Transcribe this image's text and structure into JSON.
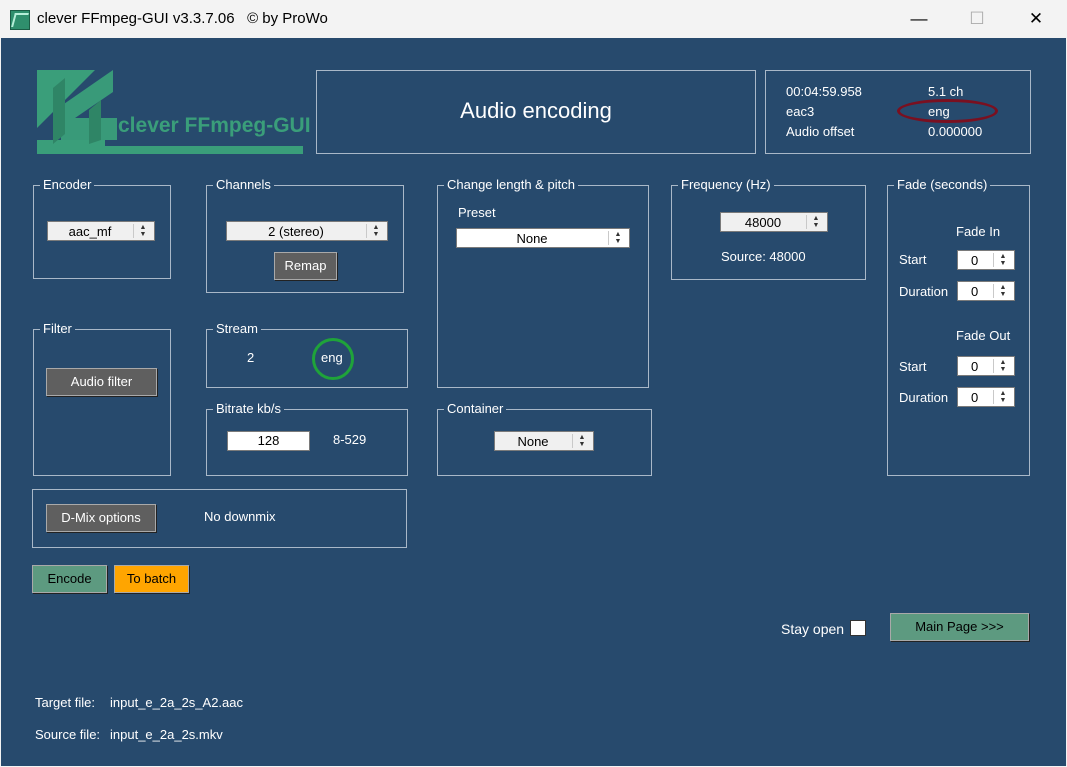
{
  "window": {
    "title": "clever FFmpeg-GUI v3.3.7.06   © by ProWo",
    "minimize_glyph": "—",
    "maximize_glyph": "☐",
    "close_glyph": "✕"
  },
  "logo": {
    "text": "clever FFmpeg-GUI",
    "color": "#3a9e7a"
  },
  "header": {
    "title": "Audio encoding"
  },
  "info": {
    "duration": "00:04:59.958",
    "channels": "5.1 ch",
    "codec": "eac3",
    "language": "eng",
    "offset_label": "Audio offset",
    "offset_value": "0.000000"
  },
  "encoder": {
    "label": "Encoder",
    "value": "aac_mf"
  },
  "channels": {
    "label": "Channels",
    "value": "2 (stereo)",
    "remap_label": "Remap"
  },
  "pitch": {
    "label": "Change length & pitch",
    "preset_label": "Preset",
    "preset_value": "None"
  },
  "frequency": {
    "label": "Frequency (Hz)",
    "value": "48000",
    "source_text": "Source: 48000"
  },
  "fade": {
    "label": "Fade (seconds)",
    "fade_in_label": "Fade In",
    "fade_out_label": "Fade Out",
    "start_label": "Start",
    "duration_label": "Duration",
    "in_start": "0",
    "in_duration": "0",
    "out_start": "0",
    "out_duration": "0"
  },
  "filter": {
    "label": "Filter",
    "button_label": "Audio filter"
  },
  "stream": {
    "label": "Stream",
    "number": "2",
    "language": "eng"
  },
  "bitrate": {
    "label": "Bitrate kb/s",
    "value": "128",
    "range": "8-529"
  },
  "container": {
    "label": "Container",
    "value": "None"
  },
  "dmix": {
    "button_label": "D-Mix options",
    "status": "No downmix"
  },
  "actions": {
    "encode_label": "Encode",
    "batch_label": "To batch",
    "stay_open_label": "Stay open",
    "main_page_label": "Main Page >>>"
  },
  "files": {
    "target_label": "Target file:",
    "target_value": "input_e_2a_2s_A2.aac",
    "source_label": "Source file:",
    "source_value": "input_e_2a_2s.mkv"
  },
  "colors": {
    "background": "#274a6d",
    "accent_green": "#5d9a80",
    "batch_orange": "#ffa500",
    "highlight_red": "#7a1020",
    "highlight_green": "#1fa33a"
  }
}
